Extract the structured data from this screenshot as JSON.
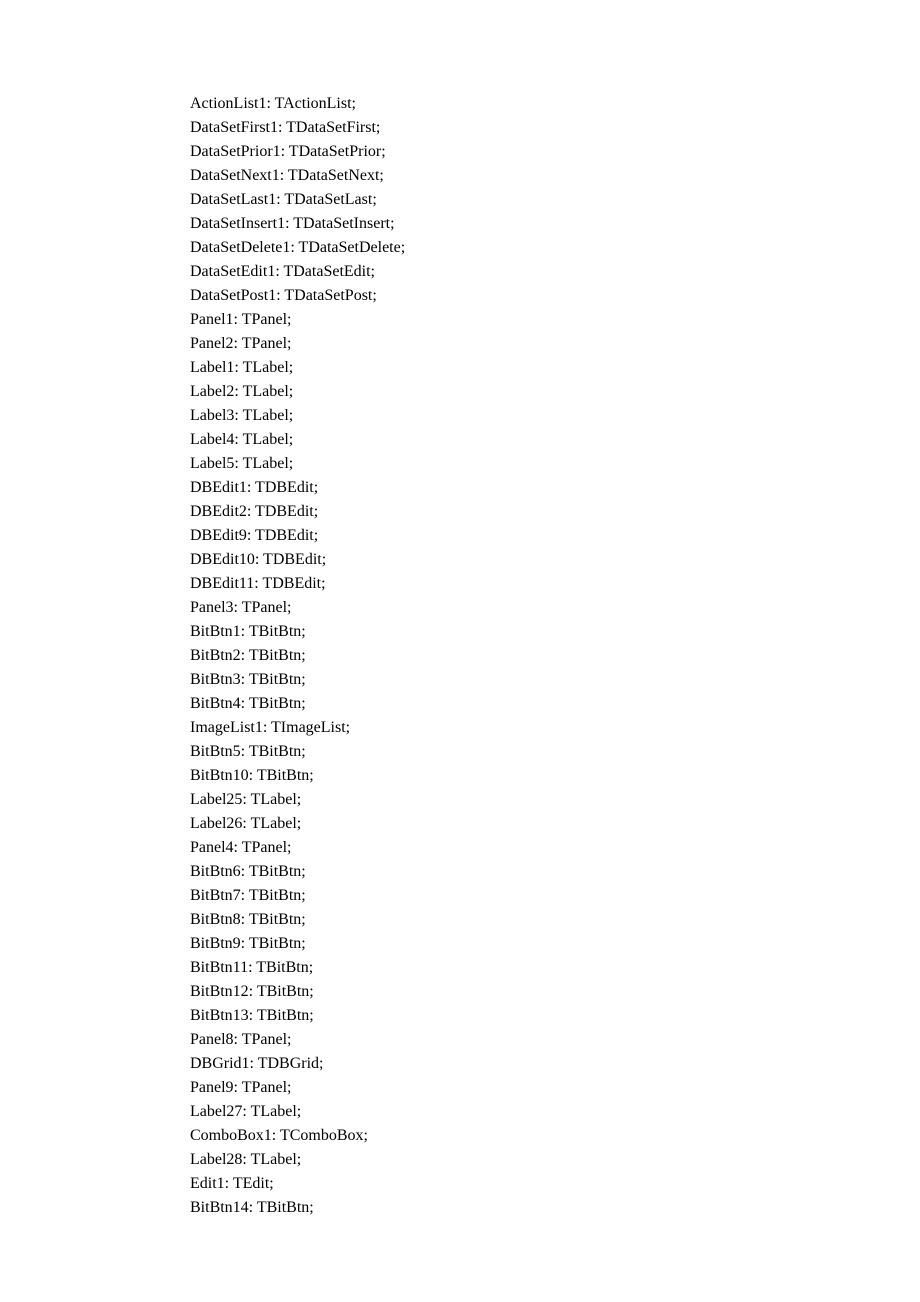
{
  "lines": [
    "ActionList1: TActionList;",
    "DataSetFirst1: TDataSetFirst;",
    "DataSetPrior1: TDataSetPrior;",
    "DataSetNext1: TDataSetNext;",
    "DataSetLast1: TDataSetLast;",
    "DataSetInsert1: TDataSetInsert;",
    "DataSetDelete1: TDataSetDelete;",
    "DataSetEdit1: TDataSetEdit;",
    "DataSetPost1: TDataSetPost;",
    "Panel1: TPanel;",
    "Panel2: TPanel;",
    "Label1: TLabel;",
    "Label2: TLabel;",
    "Label3: TLabel;",
    "Label4: TLabel;",
    "Label5: TLabel;",
    "DBEdit1: TDBEdit;",
    "DBEdit2: TDBEdit;",
    "DBEdit9: TDBEdit;",
    "DBEdit10: TDBEdit;",
    "DBEdit11: TDBEdit;",
    "Panel3: TPanel;",
    "BitBtn1: TBitBtn;",
    "BitBtn2: TBitBtn;",
    "BitBtn3: TBitBtn;",
    "BitBtn4: TBitBtn;",
    "ImageList1: TImageList;",
    "BitBtn5: TBitBtn;",
    "BitBtn10: TBitBtn;",
    "Label25: TLabel;",
    "Label26: TLabel;",
    "Panel4: TPanel;",
    "BitBtn6: TBitBtn;",
    "BitBtn7: TBitBtn;",
    "BitBtn8: TBitBtn;",
    "BitBtn9: TBitBtn;",
    "BitBtn11: TBitBtn;",
    "BitBtn12: TBitBtn;",
    "BitBtn13: TBitBtn;",
    "Panel8: TPanel;",
    "DBGrid1: TDBGrid;",
    "Panel9: TPanel;",
    "Label27: TLabel;",
    "ComboBox1: TComboBox;",
    "Label28: TLabel;",
    "Edit1: TEdit;",
    "BitBtn14: TBitBtn;"
  ]
}
